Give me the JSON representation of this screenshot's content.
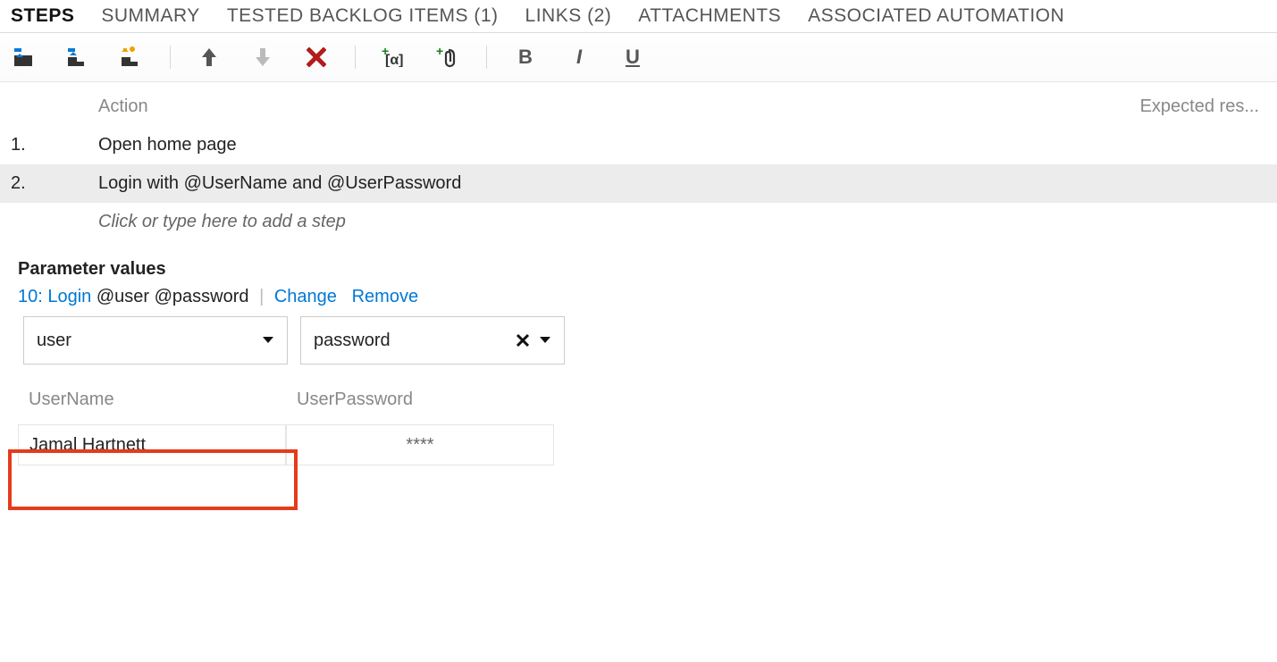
{
  "tabs": {
    "steps": "STEPS",
    "summary": "SUMMARY",
    "backlog": "TESTED BACKLOG ITEMS (1)",
    "links": "LINKS (2)",
    "attachments": "ATTACHMENTS",
    "automation": "ASSOCIATED AUTOMATION"
  },
  "columns": {
    "action": "Action",
    "expected": "Expected res..."
  },
  "steps": [
    {
      "num": "1.",
      "action": "Open home page"
    },
    {
      "num": "2.",
      "action": "Login with  @UserName and  @UserPassword"
    }
  ],
  "placeholder": "Click or type here to add a step",
  "params": {
    "title": "Parameter values",
    "link_prefix": "10: Login",
    "link_suffix": "@user @password",
    "change": "Change",
    "remove": "Remove",
    "select_user": "user",
    "select_pass": "password",
    "col_user": "UserName",
    "col_pass": "UserPassword",
    "val_user": "Jamal Hartnett",
    "val_pass": "****"
  },
  "format": {
    "bold": "B",
    "italic": "I",
    "underline": "U"
  }
}
